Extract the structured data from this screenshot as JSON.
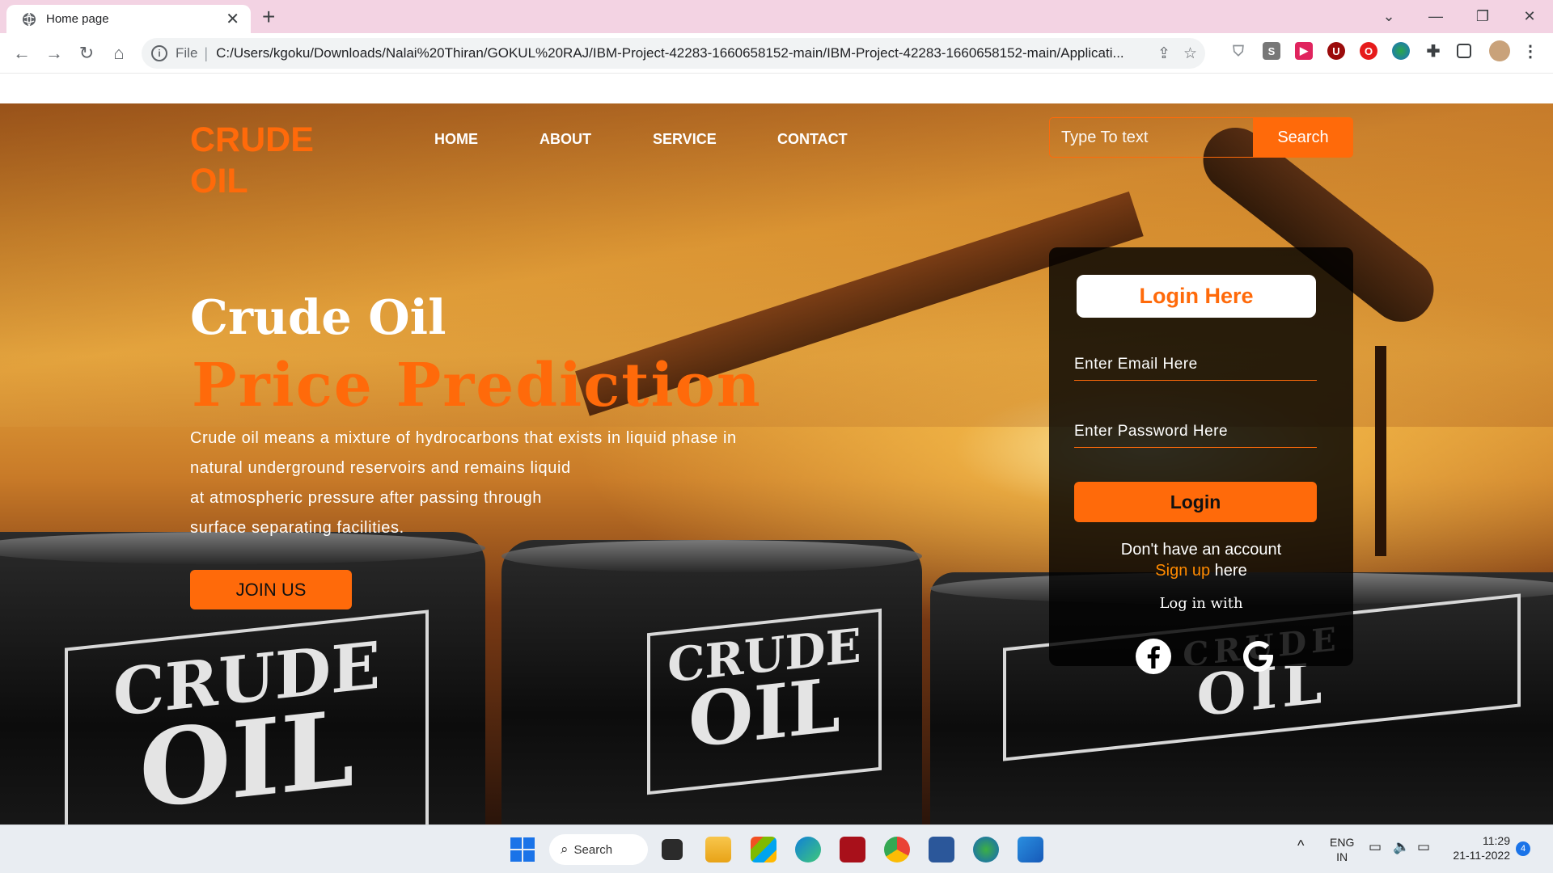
{
  "browser": {
    "tab_title": "Home page",
    "new_tab": "+",
    "url_scheme": "File",
    "url_separator": "|",
    "url": "C:/Users/kgoku/Downloads/Nalai%20Thiran/GOKUL%20RAJ/IBM-Project-42283-1660658152-main/IBM-Project-42283-1660658152-main/Applicati...",
    "extensions": [
      "S",
      "▶",
      "U",
      "O"
    ]
  },
  "site": {
    "brand_line1": "CRUDE",
    "brand_line2": "OIL",
    "nav": [
      "HOME",
      "ABOUT",
      "SERVICE",
      "CONTACT"
    ],
    "search_placeholder": "Type To text",
    "search_button": "Search"
  },
  "hero": {
    "title": "Crude Oil",
    "subtitle": "Price Prediction",
    "desc_lines": [
      "Crude oil means a mixture of hydrocarbons that exists in liquid phase in",
      "natural underground reservoirs and remains liquid",
      "at atmospheric pressure after passing through",
      "surface separating facilities."
    ],
    "join_button": "JOIN US"
  },
  "login": {
    "title": "Login Here",
    "email_placeholder": "Enter Email Here",
    "password_placeholder": "Enter Password Here",
    "login_button": "Login",
    "no_account": "Don't have an account",
    "signup_link": "Sign up",
    "signup_suffix": " here",
    "login_with": "Log in with"
  },
  "barrel_labels": [
    {
      "top": "CRUDE",
      "bottom": "OIL"
    },
    {
      "top": "CRUDE",
      "bottom": "OIL"
    },
    {
      "top": "CRUDE",
      "bottom": "OIL"
    }
  ],
  "taskbar": {
    "search_label": "Search",
    "lang_line1": "ENG",
    "lang_line2": "IN",
    "time": "11:29",
    "date": "21-11-2022",
    "notification_count": "4"
  },
  "colors": {
    "accent": "#ff6a0a",
    "signup": "#ff8a00",
    "tabbar": "#f3d3e3"
  }
}
